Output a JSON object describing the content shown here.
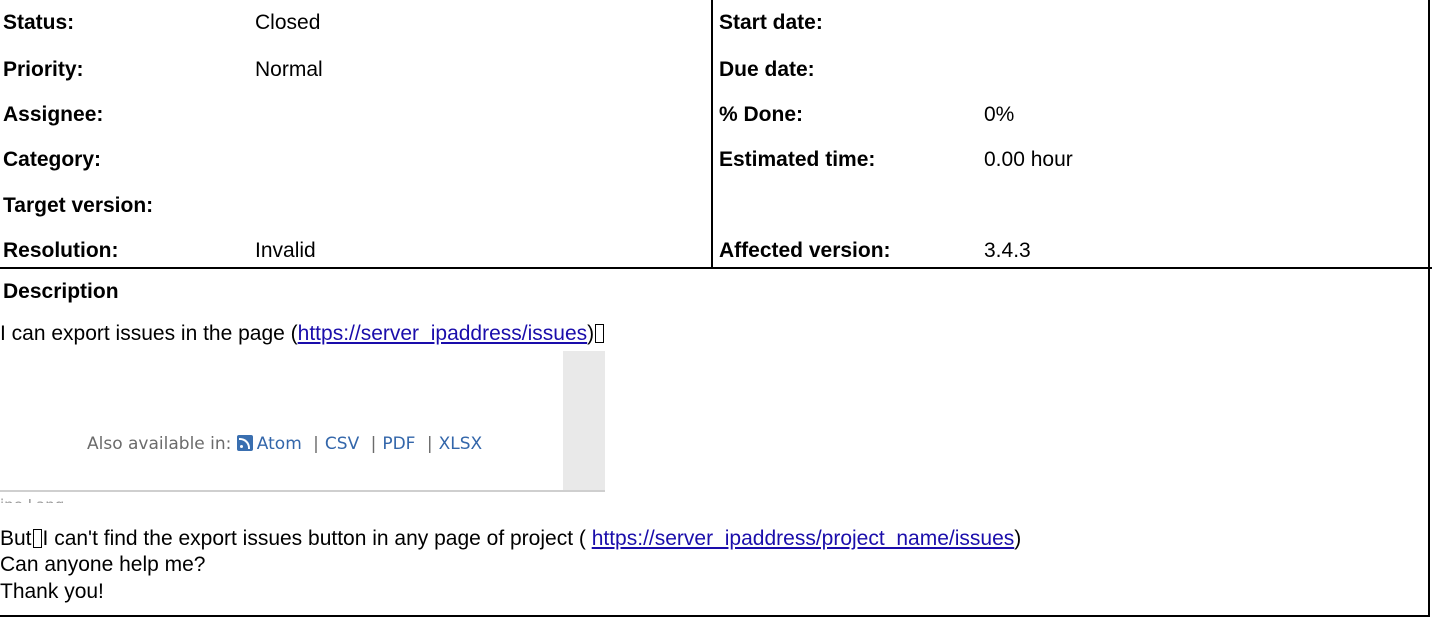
{
  "fields": {
    "status": {
      "label": "Status:",
      "value": "Closed"
    },
    "priority": {
      "label": "Priority:",
      "value": "Normal"
    },
    "assignee": {
      "label": "Assignee:",
      "value": ""
    },
    "category": {
      "label": "Category:",
      "value": ""
    },
    "target_version": {
      "label": "Target version:",
      "value": ""
    },
    "resolution": {
      "label": "Resolution:",
      "value": "Invalid"
    },
    "start_date": {
      "label": "Start date:",
      "value": ""
    },
    "due_date": {
      "label": "Due date:",
      "value": ""
    },
    "done": {
      "label": "% Done:",
      "value": "0%"
    },
    "estimated_time": {
      "label": "Estimated time:",
      "value": "0.00 hour"
    },
    "affected_version": {
      "label": "Affected version:",
      "value": "3.4.3"
    }
  },
  "description": {
    "title": "Description",
    "line1_prefix": "I can export issues in the page (",
    "line1_link": "https://server_ipaddress/issues",
    "line1_suffix": ")",
    "embedded": {
      "also_available": "Also available in:",
      "formats": [
        "Atom",
        "CSV",
        "PDF",
        "XLSX"
      ],
      "cut_text": "ine Lang"
    },
    "line2_prefix": "But",
    "line2_text": "I can't find the export issues button in any page of project ( ",
    "line2_link": "https://server_ipaddress/project_name/issues",
    "line2_suffix": ")",
    "line3": "Can anyone help me?",
    "line4": "Thank you!"
  }
}
